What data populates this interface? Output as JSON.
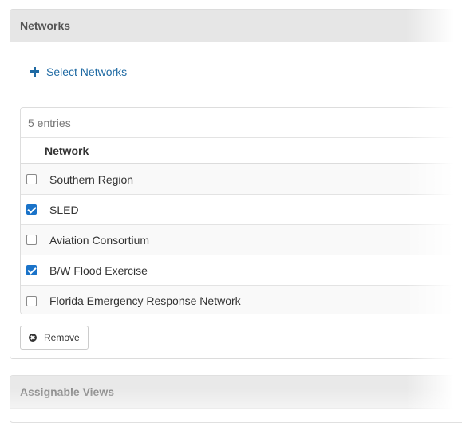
{
  "networks_panel": {
    "title": "Networks",
    "select_link_label": "Select Networks",
    "entries_text": "5 entries",
    "column_header": "Network",
    "rows": [
      {
        "name": "Southern Region",
        "checked": false
      },
      {
        "name": "SLED",
        "checked": true
      },
      {
        "name": "Aviation Consortium",
        "checked": false
      },
      {
        "name": "B/W Flood Exercise",
        "checked": true
      },
      {
        "name": "Florida Emergency Response Network",
        "checked": false
      }
    ],
    "remove_label": "Remove"
  },
  "views_panel": {
    "title": "Assignable Views"
  },
  "colors": {
    "link": "#1f6aa3",
    "checkbox_checked": "#1a73c9",
    "header_bg": "#e6e6e6"
  },
  "icons": {
    "select": "plus-icon",
    "remove": "times-circle-icon"
  }
}
